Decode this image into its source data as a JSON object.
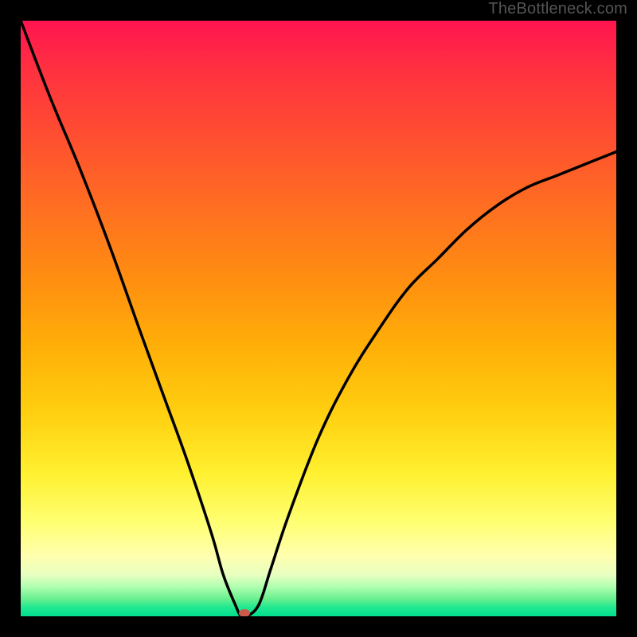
{
  "watermark": "TheBottleneck.com",
  "chart_data": {
    "type": "line",
    "title": "",
    "xlabel": "",
    "ylabel": "",
    "xlim": [
      0,
      100
    ],
    "ylim": [
      0,
      100
    ],
    "grid": false,
    "series": [
      {
        "name": "curve",
        "x": [
          0,
          5,
          10,
          15,
          20,
          24,
          28,
          32,
          34,
          36,
          37,
          38,
          40,
          42,
          45,
          50,
          55,
          60,
          65,
          70,
          75,
          80,
          85,
          90,
          95,
          100
        ],
        "values": [
          100,
          87,
          75,
          62,
          48,
          37,
          26,
          14,
          7,
          2,
          0,
          0,
          2,
          8,
          17,
          30,
          40,
          48,
          55,
          60,
          65,
          69,
          72,
          74,
          76,
          78
        ]
      }
    ],
    "marker": {
      "x": 37.5,
      "y": 0.5
    },
    "background_gradient": {
      "top": "#ff1450",
      "mid": "#ffd010",
      "bottom": "#00e090"
    }
  }
}
